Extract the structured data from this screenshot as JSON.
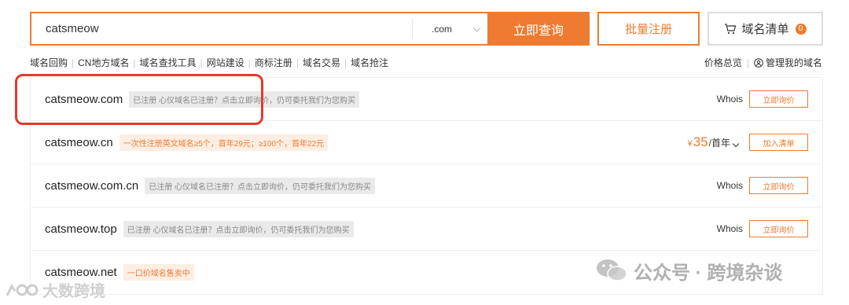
{
  "search": {
    "value": "catsmeow",
    "tld": ".com",
    "button_label": "立即查询"
  },
  "bulk_register_label": "批量注册",
  "cart": {
    "label": "域名清单",
    "count": "0"
  },
  "subnav": [
    "域名回购",
    "CN地方域名",
    "域名查找工具",
    "网站建设",
    "商标注册",
    "域名交易",
    "域名抢注"
  ],
  "rightnav": {
    "price_overview": "价格总览",
    "manage_domains": "管理我的域名"
  },
  "results": [
    {
      "domain": "catsmeow.com",
      "tag": "已注册 心仪域名已注册？点击立即询价，仍可委托我们为您购买",
      "tag_style": "gray",
      "whois": "Whois",
      "action": "立即询价"
    },
    {
      "domain": "catsmeow.cn",
      "tag": "一次性注册英文域名≥5个，首年29元；≥100个，首年22元",
      "tag_style": "orange",
      "price_symbol": "¥",
      "price": "35",
      "price_unit": "/首年",
      "action": "加入清单"
    },
    {
      "domain": "catsmeow.com.cn",
      "tag": "已注册 心仪域名已注册？点击立即询价，仍可委托我们为您购买",
      "tag_style": "gray",
      "whois": "Whois",
      "action": "立即询价"
    },
    {
      "domain": "catsmeow.top",
      "tag": "已注册 心仪域名已注册？点击立即询价，仍可委托我们为您购买",
      "tag_style": "gray",
      "whois": "Whois",
      "action": "立即询价"
    },
    {
      "domain": "catsmeow.net",
      "tag": "一口价域名售卖中",
      "tag_style": "orange"
    }
  ],
  "watermarks": {
    "left": "大数跨境",
    "right": "公众号 · 跨境杂谈"
  },
  "colors": {
    "accent": "#ee7b30",
    "highlight": "#e33a2b"
  }
}
